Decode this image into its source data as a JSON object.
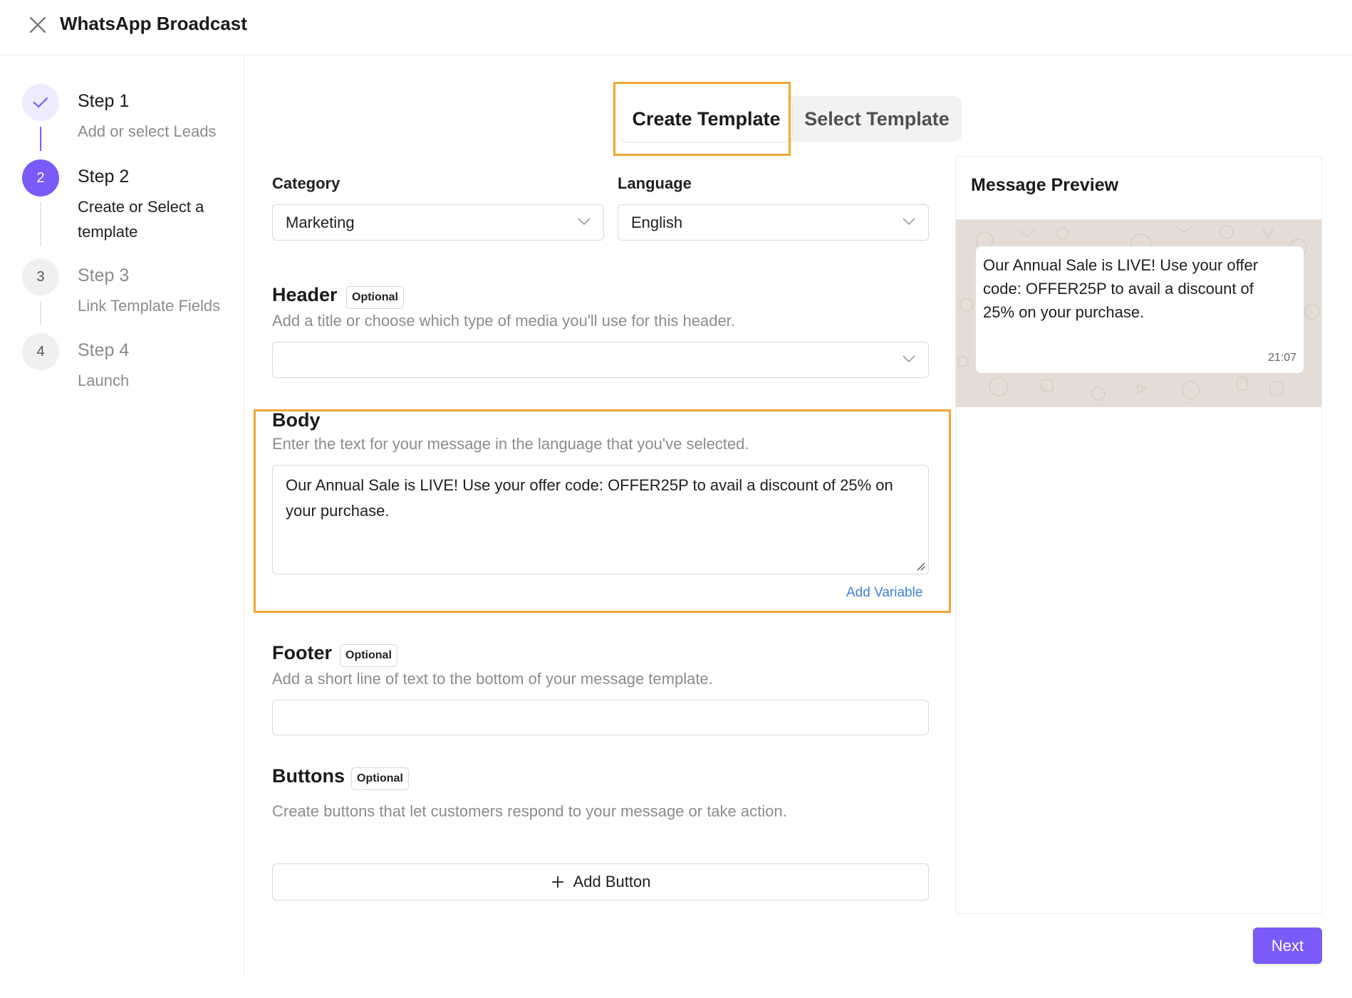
{
  "app": {
    "title": "WhatsApp Broadcast"
  },
  "steps": [
    {
      "number": "",
      "title": "Step 1",
      "subtitle": "Add or select Leads",
      "state": "done"
    },
    {
      "number": "2",
      "title": "Step 2",
      "subtitle": "Create or Select a template",
      "state": "active"
    },
    {
      "number": "3",
      "title": "Step 3",
      "subtitle": "Link Template Fields",
      "state": "pending"
    },
    {
      "number": "4",
      "title": "Step 4",
      "subtitle": "Launch",
      "state": "pending"
    }
  ],
  "tabs": {
    "create": "Create Template",
    "select": "Select Template",
    "active": "create"
  },
  "form": {
    "category": {
      "label": "Category",
      "value": "Marketing"
    },
    "language": {
      "label": "Language",
      "value": "English"
    },
    "header": {
      "title": "Header",
      "badge": "Optional",
      "helper": "Add a title or choose which type of media you'll use for this header.",
      "value": ""
    },
    "body": {
      "title": "Body",
      "helper": "Enter the text for your message in the language that you've selected.",
      "value": "Our Annual Sale is LIVE! Use your offer code: OFFER25P to avail a discount of 25% on your purchase.",
      "add_variable": "Add Variable"
    },
    "footer": {
      "title": "Footer",
      "badge": "Optional",
      "helper": "Add a short line of text to the bottom of your message template.",
      "value": ""
    },
    "buttons": {
      "title": "Buttons",
      "badge": "Optional",
      "helper": "Create buttons that let customers respond to your message or take action.",
      "add_button": "Add Button"
    }
  },
  "preview": {
    "title": "Message Preview",
    "message": "Our Annual Sale is LIVE! Use your offer code: OFFER25P to avail a discount of 25% on your purchase.",
    "time": "21:07"
  },
  "actions": {
    "next": "Next"
  },
  "colors": {
    "accent": "#7a5af8",
    "highlight": "#f0a733",
    "link": "#3b82d6",
    "chat_bg": "#e5ddd5"
  }
}
